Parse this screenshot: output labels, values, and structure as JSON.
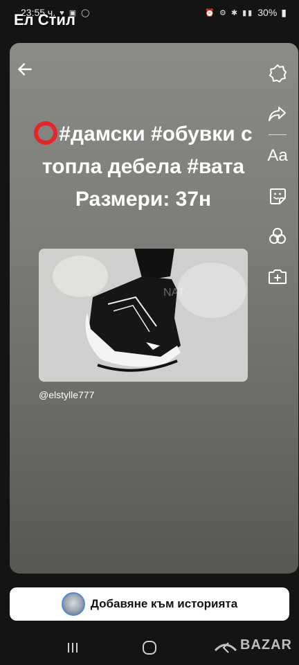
{
  "status_bar": {
    "time": "23:55 ч.",
    "left_icons": [
      "heart-broken-icon",
      "image-icon",
      "whatsapp-icon"
    ],
    "right_icons": [
      "alarm-icon",
      "settings-icon",
      "bluetooth-icon",
      "volte-icon",
      "signal-icon"
    ],
    "battery": "30%"
  },
  "app": {
    "title": "Ел Стил"
  },
  "story": {
    "caption_line1": "#дамски #обувки с",
    "caption_line2": "топла дебела #вата",
    "caption_line3": "Размери: 37н",
    "emoji": "red-circle-icon",
    "image_watermark": "NAT",
    "author": "@elstylle777",
    "side_tools": [
      "sticker-settings-icon",
      "share-icon",
      "text-tool-icon",
      "sticker-icon",
      "effects-icon",
      "add-media-icon"
    ],
    "text_tool_label": "Aa"
  },
  "add_story": {
    "label": "Добавяне към историята"
  },
  "nav": {
    "buttons": [
      "recents-icon",
      "home-icon",
      "back-icon"
    ]
  },
  "watermark": {
    "label": "BAZAR"
  },
  "colors": {
    "card_top": "#8a8b86",
    "card_bottom": "#575853",
    "emoji_red": "#e3262a",
    "background": "#141414"
  }
}
